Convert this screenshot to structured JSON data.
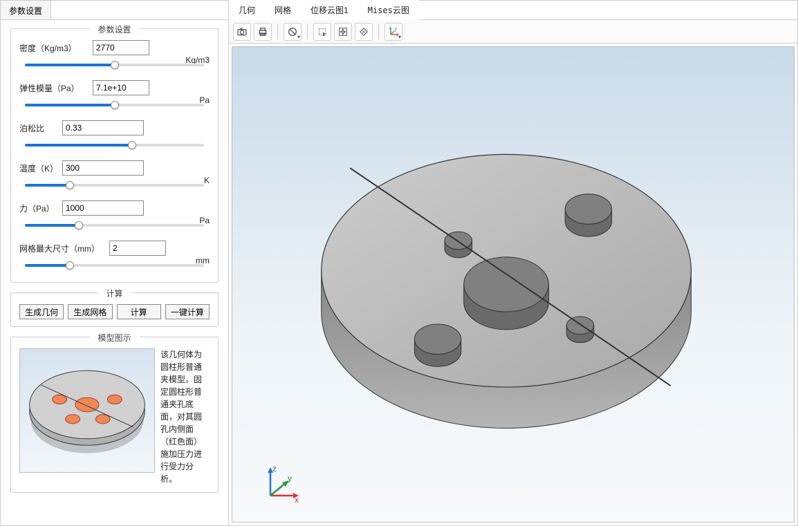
{
  "leftTab": "参数设置",
  "sections": {
    "params": {
      "title": "参数设置",
      "rows": [
        {
          "label": "密度（Kg/m3）",
          "value": "2770",
          "unit": "Kg/m3",
          "labelClass": "long",
          "input_w": 82,
          "slider": 50
        },
        {
          "label": "弹性模量（Pa）",
          "value": "7.1e+10",
          "unit": "Pa",
          "labelClass": "long",
          "input_w": 82,
          "slider": 50
        },
        {
          "label": "泊松比",
          "value": "0.33",
          "unit": "",
          "labelClass": "short",
          "input_w": 118,
          "slider": 60
        },
        {
          "label": "温度（K）",
          "value": "300",
          "unit": "K",
          "labelClass": "short",
          "input_w": 118,
          "slider": 25
        },
        {
          "label": "力（Pa）",
          "value": "1000",
          "unit": "Pa",
          "labelClass": "short",
          "input_w": 118,
          "slider": 30
        },
        {
          "label": "网格最大尺寸（mm）",
          "value": "2",
          "unit": "mm",
          "labelClass": "xlong",
          "input_w": 82,
          "slider": 25
        }
      ]
    },
    "compute": {
      "title": "计算",
      "buttons": [
        "生成几何",
        "生成网格",
        "计算",
        "一键计算"
      ]
    },
    "model": {
      "title": "模型图示",
      "desc": "该几何体为圆柱形普通夹模型。固定圆柱形普通夹孔底面，对其圆孔内侧面（红色面）施加压力进行受力分析。"
    }
  },
  "rightTabs": [
    "几何",
    "网格",
    "位移云图1",
    "Mises云图"
  ],
  "activeRightTab": 0,
  "toolbar": {
    "icons": [
      "camera-icon",
      "printer-icon",
      "forbid-icon",
      "rect-select-icon",
      "fit-icon",
      "rotate-icon",
      "axes-icon"
    ]
  }
}
